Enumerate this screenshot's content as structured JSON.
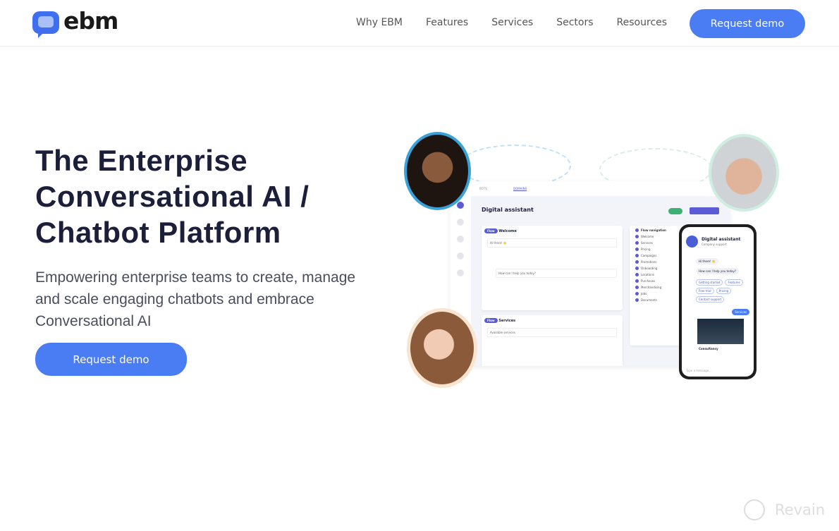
{
  "nav": {
    "logo": "ebm",
    "items": [
      "Why EBM",
      "Features",
      "Services",
      "Sectors",
      "Resources"
    ],
    "cta": "Request demo"
  },
  "hero": {
    "title": "The Enterprise Conversational AI / Chatbot Platform",
    "subtitle": "Empowering enterprise teams to create, manage and scale engaging chatbots and embrace Conversational AI",
    "cta": "Request demo"
  },
  "illustration": {
    "dashboard_title": "Digital assistant",
    "flow_nav_title": "Flow navigation",
    "flow1": "Welcome",
    "flow2": "Services",
    "flow1_msg": "Hi there! 👋",
    "flow1_msg2": "How can I help you today?",
    "flow2_section": "Available services",
    "flow_nav": [
      "Welcome",
      "Services",
      "Pricing",
      "Campaigns",
      "Promotions",
      "Onboarding",
      "Locations",
      "Purchases",
      "Merchandising",
      "Jobs",
      "Documents"
    ],
    "phone_title": "Digital assistant",
    "phone_subtitle": "Company support",
    "phone_msgs": [
      "Hi there! 👋",
      "How can I help you today?"
    ],
    "phone_chips": [
      "Getting started",
      "Features",
      "Free trial",
      "Pricing",
      "Contact support"
    ],
    "phone_reply": "Services",
    "phone_card": "Consultancy",
    "phone_input": "Type a message..."
  },
  "watermark": "Revain",
  "colors": {
    "accent": "#4a7cf4",
    "heading": "#1c1f3a"
  }
}
